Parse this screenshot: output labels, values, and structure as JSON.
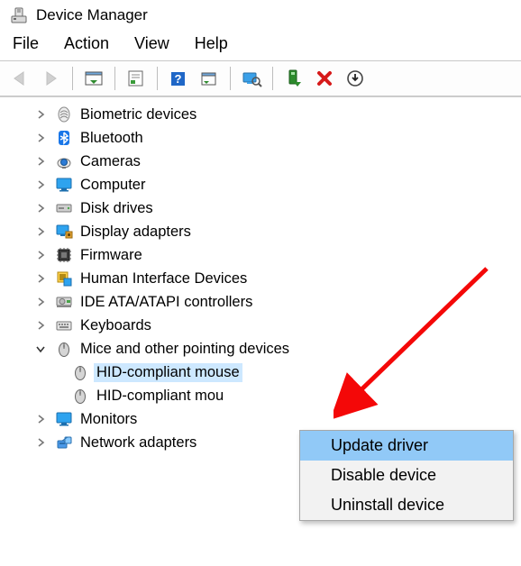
{
  "window": {
    "title": "Device Manager"
  },
  "menu": {
    "file": "File",
    "action": "Action",
    "view": "View",
    "help": "Help"
  },
  "tree": {
    "items": [
      {
        "label": "Biometric devices",
        "icon": "fingerprint"
      },
      {
        "label": "Bluetooth",
        "icon": "bluetooth"
      },
      {
        "label": "Cameras",
        "icon": "camera"
      },
      {
        "label": "Computer",
        "icon": "monitor"
      },
      {
        "label": "Disk drives",
        "icon": "drive"
      },
      {
        "label": "Display adapters",
        "icon": "display-adapter"
      },
      {
        "label": "Firmware",
        "icon": "chip"
      },
      {
        "label": "Human Interface Devices",
        "icon": "hid"
      },
      {
        "label": "IDE ATA/ATAPI controllers",
        "icon": "ide"
      },
      {
        "label": "Keyboards",
        "icon": "keyboard"
      },
      {
        "label": "Mice and other pointing devices",
        "icon": "mouse",
        "expanded": true,
        "children": [
          {
            "label": "HID-compliant mouse",
            "selected": true
          },
          {
            "label": "HID-compliant mou"
          }
        ]
      },
      {
        "label": "Monitors",
        "icon": "monitor2"
      },
      {
        "label": "Network adapters",
        "icon": "network"
      }
    ]
  },
  "contextMenu": {
    "items": [
      {
        "label": "Update driver",
        "hover": true
      },
      {
        "label": "Disable device"
      },
      {
        "label": "Uninstall device"
      }
    ]
  }
}
